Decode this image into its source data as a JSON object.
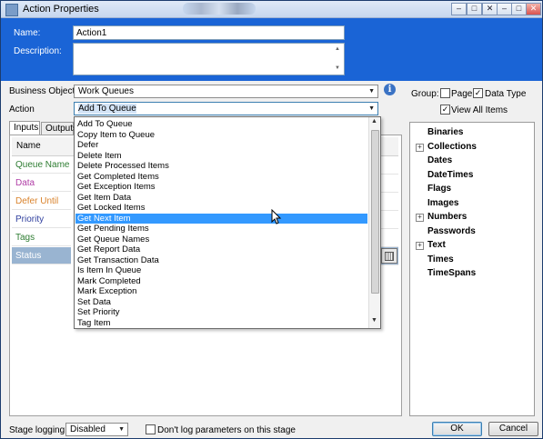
{
  "window": {
    "title": "Action Properties",
    "controls": [
      "–",
      "□",
      "✕"
    ],
    "controls2": [
      "–",
      "□",
      "✕"
    ]
  },
  "header": {
    "name_label": "Name:",
    "name_value": "Action1",
    "description_label": "Description:",
    "description_value": ""
  },
  "business_object": {
    "label": "Business Object",
    "value": "Work Queues"
  },
  "action": {
    "label": "Action",
    "value": "Add To Queue"
  },
  "group": {
    "label": "Group:",
    "options": [
      {
        "label": "Page",
        "checked": false
      },
      {
        "label": "Data Type",
        "checked": true
      },
      {
        "label": "View All Items",
        "checked": true
      }
    ]
  },
  "tabs": [
    "Inputs",
    "Outputs"
  ],
  "grid": {
    "header": "Name",
    "rows": [
      {
        "name": "Queue Name",
        "color": "#2e7d32"
      },
      {
        "name": "Data",
        "color": "#b03da6"
      },
      {
        "name": "Defer Until",
        "color": "#d9822b"
      },
      {
        "name": "Priority",
        "color": "#2f3f9e"
      },
      {
        "name": "Tags",
        "color": "#2e7d32"
      },
      {
        "name": "Status",
        "color": "#ffffff"
      }
    ]
  },
  "dropdown_items": [
    "Add To Queue",
    "Copy Item to Queue",
    "Defer",
    "Delete Item",
    "Delete Processed Items",
    "Get Completed Items",
    "Get Exception Items",
    "Get Item Data",
    "Get Locked Items",
    "Get Next Item",
    "Get Pending Items",
    "Get Queue Names",
    "Get Report Data",
    "Get Transaction Data",
    "Is Item In Queue",
    "Mark Completed",
    "Mark Exception",
    "Set Data",
    "Set Priority",
    "Tag Item"
  ],
  "dropdown_highlight_index": 9,
  "data_types": [
    {
      "label": "Binaries",
      "expandable": false
    },
    {
      "label": "Collections",
      "expandable": true
    },
    {
      "label": "Dates",
      "expandable": false
    },
    {
      "label": "DateTimes",
      "expandable": false
    },
    {
      "label": "Flags",
      "expandable": false
    },
    {
      "label": "Images",
      "expandable": false
    },
    {
      "label": "Numbers",
      "expandable": true
    },
    {
      "label": "Passwords",
      "expandable": false
    },
    {
      "label": "Text",
      "expandable": true
    },
    {
      "label": "Times",
      "expandable": false
    },
    {
      "label": "TimeSpans",
      "expandable": false
    }
  ],
  "footer": {
    "stage_logging_label": "Stage logging:",
    "stage_logging_value": "Disabled",
    "dont_log_label": "Don't log parameters on this stage",
    "dont_log_checked": false,
    "ok_label": "OK",
    "cancel_label": "Cancel"
  },
  "colors": {
    "header_blue": "#1a64d6",
    "highlight": "#3399ff"
  }
}
